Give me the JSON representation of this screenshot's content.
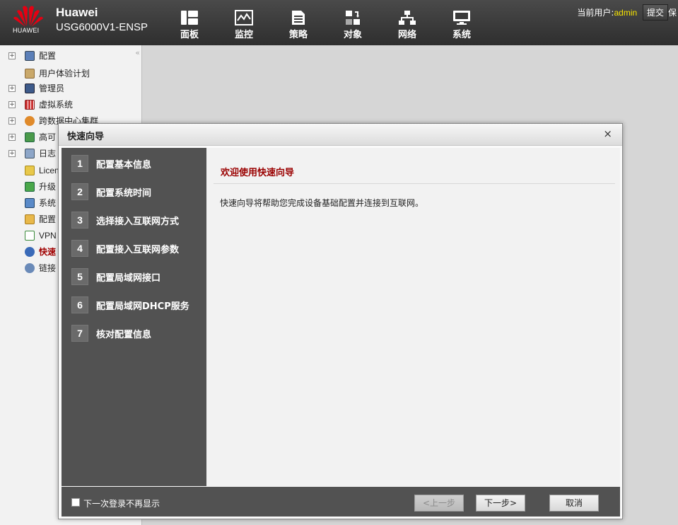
{
  "header": {
    "logo_text": "HUAWEI",
    "brand": "Huawei",
    "model": "USG6000V1-ENSP",
    "nav": [
      {
        "label": "面板",
        "icon": "dashboard-icon"
      },
      {
        "label": "监控",
        "icon": "monitor-icon"
      },
      {
        "label": "策略",
        "icon": "policy-icon"
      },
      {
        "label": "对象",
        "icon": "object-icon"
      },
      {
        "label": "网络",
        "icon": "network-icon"
      },
      {
        "label": "系统",
        "icon": "system-icon"
      }
    ],
    "user_label": "当前用户:",
    "user_name": "admin",
    "submit_label": "提交",
    "accent_user": "#f7e400"
  },
  "sidebar": {
    "collapse": "«",
    "items": [
      {
        "label": "配置",
        "expand": "+"
      },
      {
        "label": "用户体验计划"
      },
      {
        "label": "管理员",
        "expand": "+"
      },
      {
        "label": "虚拟系统",
        "expand": "+"
      },
      {
        "label": "跨数据中心集群",
        "expand": "+"
      },
      {
        "label": "高可",
        "expand": "+"
      },
      {
        "label": "日志",
        "expand": "+"
      },
      {
        "label": "Licen"
      },
      {
        "label": "升级"
      },
      {
        "label": "系统"
      },
      {
        "label": "配置"
      },
      {
        "label": "VPN"
      },
      {
        "label": "快速"
      },
      {
        "label": "链接"
      }
    ]
  },
  "dialog": {
    "title": "快速向导",
    "close": "×",
    "steps": [
      {
        "num": "1",
        "label": "配置基本信息"
      },
      {
        "num": "2",
        "label": "配置系统时间"
      },
      {
        "num": "3",
        "label": "选择接入互联网方式"
      },
      {
        "num": "4",
        "label": "配置接入互联网参数"
      },
      {
        "num": "5",
        "label": "配置局域网接口"
      },
      {
        "num": "6",
        "label": "配置局域网DHCP服务"
      },
      {
        "num": "7",
        "label": "核对配置信息"
      }
    ],
    "panel_title": "欢迎使用快速向导",
    "panel_desc": "快速向导将帮助您完成设备基础配置并连接到互联网。",
    "footer": {
      "checkbox_label": "下一次登录不再显示",
      "prev": "<上一步",
      "next": "下一步>",
      "cancel": "取消"
    }
  },
  "colors": {
    "header_bg": "#3a3a3a",
    "step_bg": "#525252",
    "title_red": "#9a0000",
    "huawei_red": "#e60012"
  }
}
